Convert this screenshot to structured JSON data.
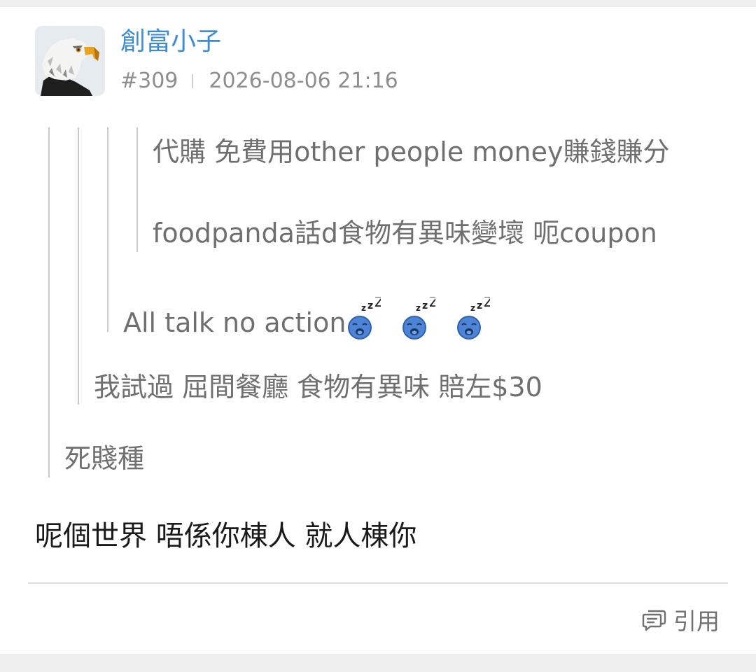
{
  "post": {
    "username": "創富小子",
    "post_number": "#309",
    "timestamp": "2026-08-06 21:16",
    "avatar_icon": "eagle-avatar-icon",
    "quotes": {
      "level4_line1": "代購 免費用other people money賺錢賺分",
      "level4_line2": "foodpanda話d食物有異味變壞 呃coupon",
      "level3": "All talk no action",
      "level3_emoji": "sleeping-zzz-icon",
      "level2": "我試過 屈間餐廳 食物有異味 賠左$30",
      "level1": "死賤種"
    },
    "reply": "呢個世界 唔係你棟人 就人棟你",
    "quote_button_label": "引用",
    "quote_button_icon": "quote-chat-icon"
  },
  "colors": {
    "username": "#3b8bd5",
    "meta": "#8e8e8e",
    "quoted_text": "#6f6f6f",
    "reply_text": "#1a1a1a",
    "quote_line": "#c9c9c9",
    "page_background": "#efefef",
    "card_background": "#ffffff"
  }
}
